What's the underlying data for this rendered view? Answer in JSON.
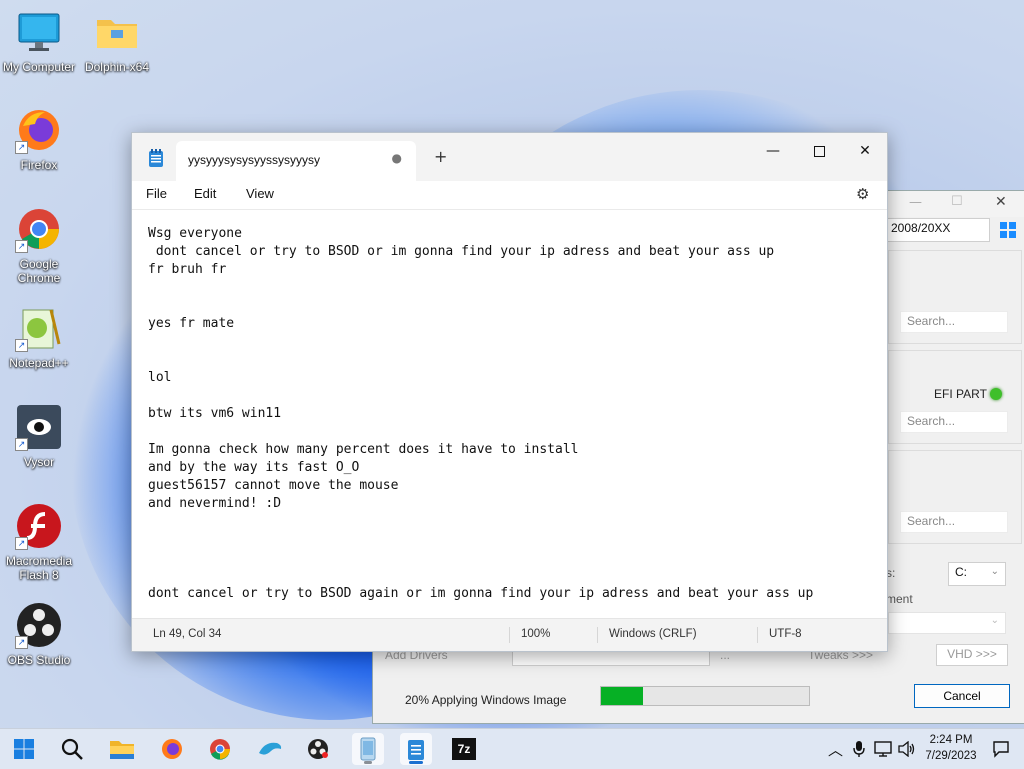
{
  "desktop": {
    "icons": [
      {
        "label": "My Computer",
        "icon": "monitor-icon"
      },
      {
        "label": "Dolphin-x64",
        "icon": "folder-icon"
      },
      {
        "label": "Firefox",
        "icon": "firefox-icon"
      },
      {
        "label": "Google Chrome",
        "icon": "chrome-icon"
      },
      {
        "label": "Notepad++",
        "icon": "notepadpp-icon"
      },
      {
        "label": "Vysor",
        "icon": "vysor-icon"
      },
      {
        "label": "Macromedia Flash 8",
        "icon": "flash-icon"
      },
      {
        "label": "OBS Studio",
        "icon": "obs-icon"
      }
    ]
  },
  "installer": {
    "version_value": "2008/20XX",
    "efi_label": "EFI PART",
    "search_placeholder_1": "Search...",
    "search_placeholder_2": "Search...",
    "search_placeholder_3": "Search...",
    "drive_value": "C:",
    "partial_label_1": "s:",
    "partial_label_2": "ment",
    "add_drivers_label": "Add Drivers",
    "tweaks_label": "Tweaks >>>",
    "vhd_label": "VHD >>>",
    "dots_label": "...",
    "status_text": "20% Applying Windows Image",
    "progress_percent": 20,
    "cancel_label": "Cancel",
    "status_led_color": "#3fbf2a"
  },
  "notepad": {
    "tab_title": "yysyyysysysyyssysyyysy",
    "unsaved_marker": "●",
    "new_tab_label": "+",
    "menu": [
      "File",
      "Edit",
      "View"
    ],
    "content": "Wsg everyone\n dont cancel or try to BSOD or im gonna find your ip adress and beat your ass up\nfr bruh fr\n\n\nyes fr mate\n\n\nlol\n\nbtw its vm6 win11\n\nIm gonna check how many percent does it have to install\nand by the way its fast O_O\nguest56157 cannot move the mouse\nand nevermind! :D\n\n\n\n\ndont cancel or try to BSOD again or im gonna find your ip adress and beat your ass up",
    "status": {
      "position": "Ln 49, Col 34",
      "zoom": "100%",
      "line_ending": "Windows (CRLF)",
      "encoding": "UTF-8"
    }
  },
  "taskbar": {
    "apps": [
      "start-icon",
      "search-icon",
      "file-explorer-icon",
      "firefox-icon",
      "chrome-icon",
      "dolphin-icon",
      "obs-icon",
      "vysor-icon",
      "notepad-icon",
      "7zip-icon"
    ],
    "zip_label": "7z",
    "clock_time": "2:24 PM",
    "clock_date": "7/29/2023"
  }
}
